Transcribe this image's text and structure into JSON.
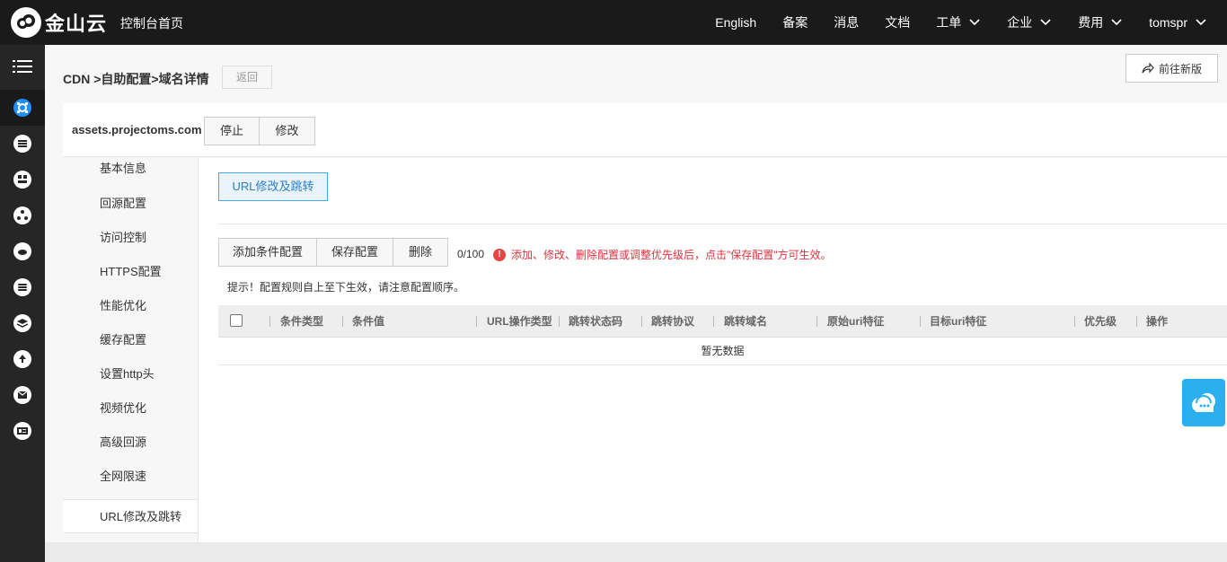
{
  "brand": {
    "name": "金山云"
  },
  "topbar": {
    "console_home": "控制台首页",
    "nav": [
      {
        "label": "English",
        "dropdown": false
      },
      {
        "label": "备案",
        "dropdown": false
      },
      {
        "label": "消息",
        "dropdown": false
      },
      {
        "label": "文档",
        "dropdown": false
      },
      {
        "label": "工单",
        "dropdown": true
      },
      {
        "label": "企业",
        "dropdown": true
      },
      {
        "label": "费用",
        "dropdown": true
      },
      {
        "label": "tomspr",
        "dropdown": true
      }
    ]
  },
  "sidebar": {
    "icons": [
      "menu-icon",
      "cdn-icon",
      "server-icon",
      "app-icon",
      "network-icon",
      "cloud-icon",
      "database-icon",
      "layers-icon",
      "upload-icon",
      "mail-icon",
      "id-card-icon"
    ],
    "active_index": 1
  },
  "header": {
    "breadcrumb": "CDN >自助配置>域名详情",
    "back_label": "返回",
    "new_version_label": "前往新版"
  },
  "domain": {
    "name": "assets.projectoms.com",
    "stop_label": "停止",
    "edit_label": "修改"
  },
  "menu": {
    "items": [
      "基本信息",
      "回源配置",
      "访问控制",
      "HTTPS配置",
      "性能优化",
      "缓存配置",
      "设置http头",
      "视频优化",
      "高级回源",
      "全网限速",
      "URL修改及跳转"
    ],
    "active": "URL修改及跳转"
  },
  "content": {
    "tab_label": "URL修改及跳转",
    "add_condition_label": "添加条件配置",
    "save_config_label": "保存配置",
    "delete_label": "删除",
    "count": "0/100",
    "warning": "添加、修改、删除配置或调整优先级后，点击\"保存配置\"方可生效。",
    "tip": "提示！配置规则自上至下生效，请注意配置顺序。",
    "columns": [
      "条件类型",
      "条件值",
      "URL操作类型",
      "跳转状态码",
      "跳转协议",
      "跳转域名",
      "原始uri特征",
      "目标uri特征",
      "优先级",
      "操作"
    ],
    "empty_text": "暂无数据"
  },
  "colors": {
    "topbar_bg": "#1a1a1a",
    "accent": "#1e90ff",
    "warning": "#d9333f",
    "help_float": "#2ab0ee"
  }
}
